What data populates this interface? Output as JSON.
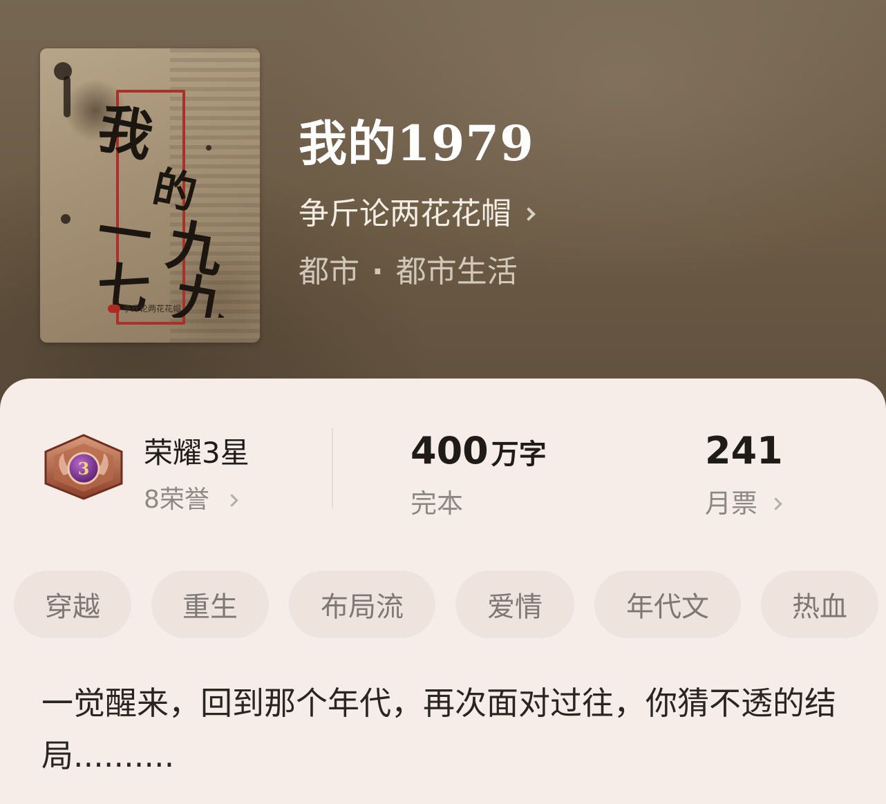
{
  "book": {
    "cover_title_chars": [
      "我",
      "的",
      "一",
      "九",
      "七",
      "九"
    ],
    "cover_publisher": "争斤论两花花帽",
    "title": "我的1979",
    "author": "争斤论两花花帽",
    "category": "都市",
    "category_separator": "·",
    "subcategory": "都市生活"
  },
  "stats": {
    "rank_badge_number": "3",
    "rank_name": "荣耀3星",
    "honor_count": "8荣誉",
    "word_count": "400",
    "word_unit": "万字",
    "status": "完本",
    "monthly_votes": "241",
    "monthly_votes_label": "月票"
  },
  "tags": [
    "穿越",
    "重生",
    "布局流",
    "爱情",
    "年代文",
    "热血"
  ],
  "description": "一觉醒来，回到那个年代，再次面对过往，你猜不透的结局..........",
  "colors": {
    "header_bg": "#6d5d49",
    "card_bg": "#f7ede8",
    "tag_bg": "#efe3de",
    "badge_bronze": "#a0553a",
    "badge_purple": "#7a2f8f",
    "cover_frame_red": "#a8322a"
  },
  "icons": {
    "author_chevron": "chevron-right-icon",
    "honor_chevron": "chevron-right-icon",
    "votes_chevron": "chevron-right-icon",
    "badge": "bronze-hexagon-medal-icon"
  }
}
